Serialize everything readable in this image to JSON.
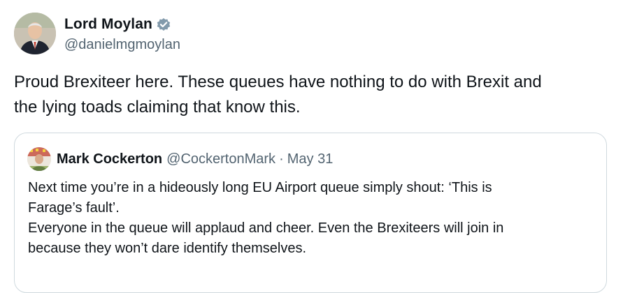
{
  "author": {
    "display_name": "Lord Moylan",
    "handle": "@danielmgmoylan",
    "verified": true
  },
  "tweet": {
    "text_line1": "Proud Brexiteer here. These queues have nothing to do with Brexit and",
    "text_line2": "the lying toads claiming that know this."
  },
  "quoted_tweet": {
    "display_name": "Mark Cockerton",
    "handle": "@CockertonMark",
    "separator": "·",
    "date": "May 31",
    "line1": "Next time you’re in a hideously long EU Airport queue simply shout: ‘This is",
    "line2": "Farage’s fault’.",
    "line3": "Everyone in the queue will applaud and cheer. Even the Brexiteers will join in",
    "line4": "because they won’t dare identify themselves."
  },
  "colors": {
    "text": "#0f1419",
    "secondary": "#536471",
    "border": "#cfd9de",
    "verified_badge": "#829aab"
  }
}
